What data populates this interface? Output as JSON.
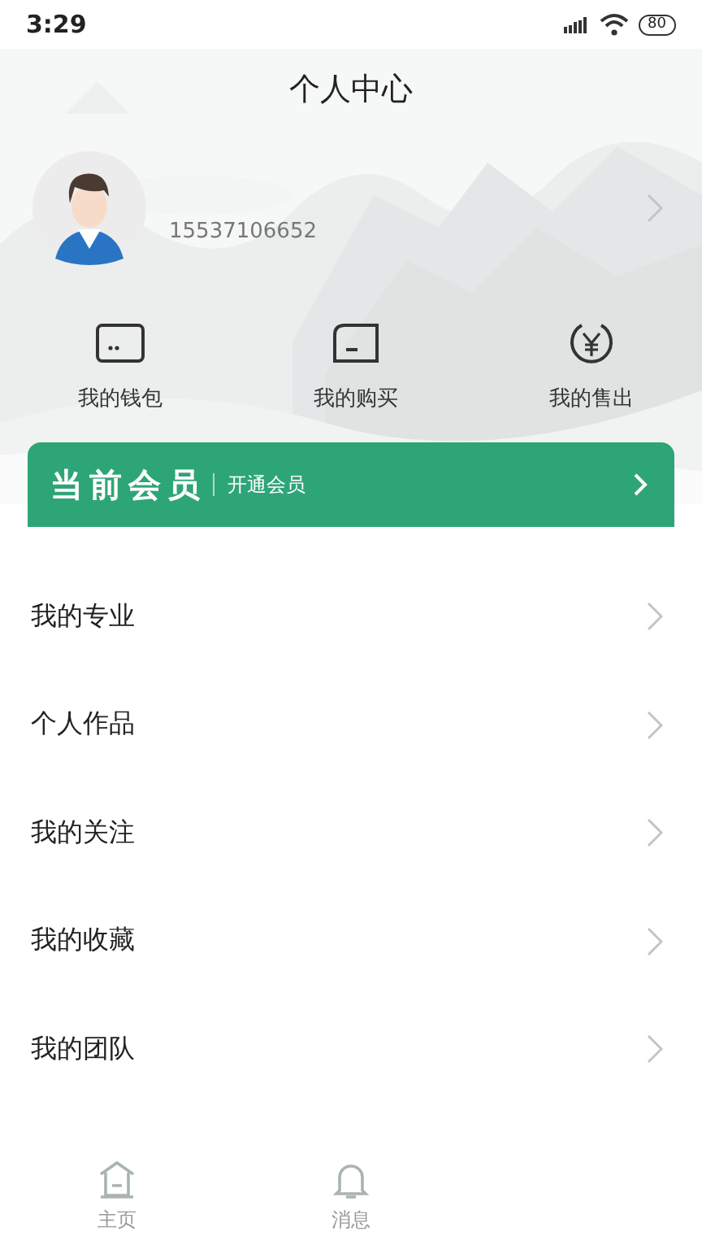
{
  "status_bar": {
    "time": "3:29",
    "battery": "80"
  },
  "header": {
    "title": "个人中心"
  },
  "profile": {
    "phone": "15537106652"
  },
  "shortcuts": [
    {
      "kind": "wallet",
      "label": "我的钱包"
    },
    {
      "kind": "purchase",
      "label": "我的购买"
    },
    {
      "kind": "sales",
      "label": "我的售出"
    }
  ],
  "membership": {
    "title": "当前会员",
    "action": "开通会员"
  },
  "menu": [
    "我的专业",
    "个人作品",
    "我的关注",
    "我的收藏",
    "我的团队"
  ],
  "tab_bar": [
    {
      "kind": "home",
      "label": "主页",
      "selected": false
    },
    {
      "kind": "messages",
      "label": "消息",
      "selected": false
    }
  ]
}
